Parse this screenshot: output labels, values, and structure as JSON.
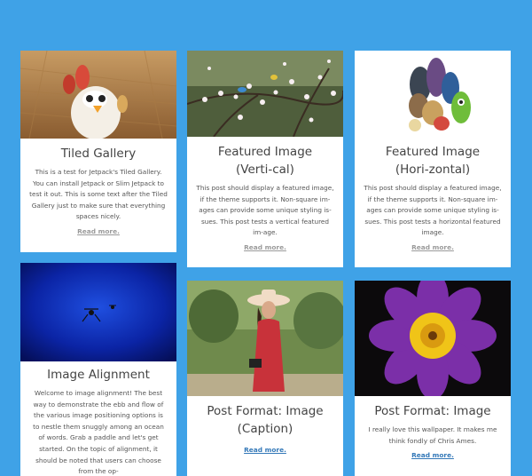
{
  "colors": {
    "background": "#3fa2e7",
    "card": "#ffffff",
    "link": "#3378b8",
    "link_muted": "#9a9a9a"
  },
  "posts": [
    {
      "title": "Tiled Gallery",
      "excerpt": "This is a test for Jetpack's Tiled Gallery. You can install Jetpack or Slim Jetpack to test it out. This is some text after the Tiled Gallery just to make sure that everything spaces nicely.",
      "more": "Read more."
    },
    {
      "title": "Featured Image (Verti-cal)",
      "excerpt": "This post should display a featured image, if the theme supports it. Non-square im-ages can provide some unique styling is-sues. This post tests a vertical featured im-age.",
      "more": "Read more."
    },
    {
      "title": "Featured Image (Hori-zontal)",
      "excerpt": "This post should display a featured image, if the theme supports it. Non-square im-ages can provide some unique styling is-sues. This post tests a horizontal featured image.",
      "more": "Read more."
    },
    {
      "title": "Image Alignment",
      "excerpt": "Welcome to image alignment! The best way to demonstrate the ebb and flow of the various image positioning options is to nestle them snuggly among an ocean of words. Grab a paddle and let's get started. On the topic of alignment, it should be noted that users can choose from the op-"
    },
    {
      "title": "Post Format: Image (Caption)",
      "more": "Read more."
    },
    {
      "title": "Post Format: Image",
      "excerpt": "I really love this wallpaper. It makes me think fondly of Chris Ames.",
      "more": "Read more."
    }
  ]
}
